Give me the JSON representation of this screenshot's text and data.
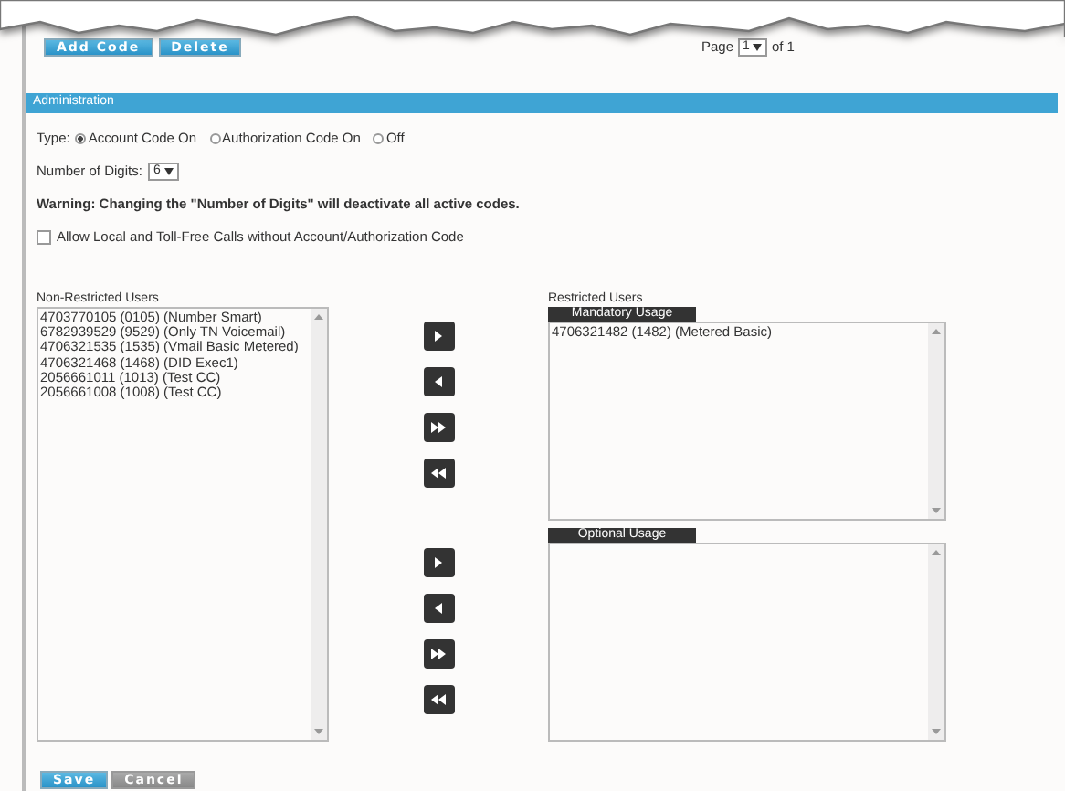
{
  "toolbar": {
    "buttons": [
      {
        "label": "Add Code",
        "kind": "primary"
      },
      {
        "label": "Delete",
        "kind": "primary"
      }
    ],
    "pager": {
      "prefix": "Page",
      "value": "1",
      "suffix": "of 1"
    }
  },
  "section": {
    "title": "Administration"
  },
  "type": {
    "label": "Type:",
    "options": [
      {
        "label": "Account Code On",
        "selected": true
      },
      {
        "label": "Authorization Code On",
        "selected": false
      },
      {
        "label": "Off",
        "selected": false
      }
    ]
  },
  "digits": {
    "label": "Number of Digits:",
    "value": "6"
  },
  "warning": "Warning: Changing the \"Number of Digits\" will deactivate all active codes.",
  "allow_checkbox": {
    "label": "Allow Local and Toll-Free Calls without Account/Authorization Code",
    "checked": false
  },
  "non_restricted": {
    "label": "Non-Restricted Users",
    "items": [
      "4703770105 (0105) (Number Smart)",
      "6782939529 (9529) (Only TN Voicemail)",
      "4706321535 (1535) (Vmail Basic Metered)",
      "4706321468 (1468) (DID Exec1)",
      "2056661011 (1013) (Test CC)",
      "2056661008 (1008) (Test CC)"
    ]
  },
  "transfer_groups": [
    [
      {
        "kind": "add"
      },
      {
        "kind": "remove"
      },
      {
        "kind": "add_all"
      },
      {
        "kind": "remove_all"
      }
    ],
    [
      {
        "kind": "add"
      },
      {
        "kind": "remove"
      },
      {
        "kind": "add_all"
      },
      {
        "kind": "remove_all"
      }
    ]
  ],
  "restricted": {
    "label": "Restricted Users",
    "lists": [
      {
        "title": "Mandatory Usage",
        "items": [
          "4706321482 (1482) (Metered Basic)"
        ]
      },
      {
        "title": "Optional Usage"
      }
    ]
  },
  "footer_buttons": [
    {
      "label": "Save",
      "kind": "primary"
    },
    {
      "label": "Cancel",
      "kind": "secondary"
    }
  ]
}
